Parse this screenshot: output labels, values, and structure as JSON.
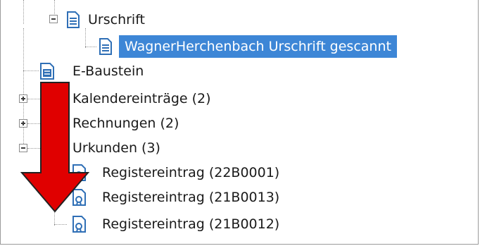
{
  "tree": {
    "items": [
      {
        "label": "Urschrift",
        "icon": "document-icon",
        "expanded": true
      },
      {
        "label": "WagnerHerchenbach Urschrift gescannt",
        "icon": "document-icon",
        "selected": true
      },
      {
        "label": "E-Baustein",
        "icon": "text-block-icon"
      },
      {
        "label": "Kalendereinträge (2)",
        "expanded": false
      },
      {
        "label": "Rechnungen (2)",
        "expanded": false
      },
      {
        "label": "Urkunden (3)",
        "expanded": true
      },
      {
        "label": "Registereintrag (22B0001)",
        "icon": "certificate-icon"
      },
      {
        "label": "Registereintrag (21B0013)",
        "icon": "certificate-icon"
      },
      {
        "label": "Registereintrag (21B0012)",
        "icon": "certificate-icon"
      }
    ]
  },
  "colors": {
    "selection": "#3d86d6",
    "arrow": "#e00000",
    "arrow_outline": "#222222",
    "icon_blue": "#2f6fb6"
  }
}
